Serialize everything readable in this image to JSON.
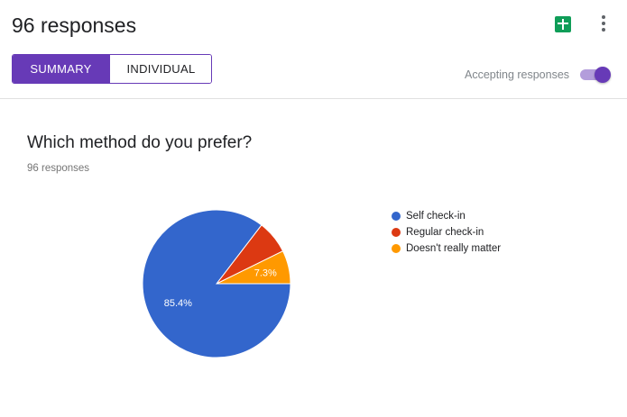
{
  "header": {
    "title": "96 responses",
    "sheets_icon": "google-sheets-icon",
    "more_icon": "more-vert-icon"
  },
  "tabs": [
    {
      "label": "SUMMARY",
      "active": true
    },
    {
      "label": "INDIVIDUAL",
      "active": false
    }
  ],
  "accepting": {
    "label": "Accepting responses",
    "enabled": true
  },
  "question": {
    "title": "Which method do you prefer?",
    "response_count": "96 responses"
  },
  "chart_data": {
    "type": "pie",
    "slices": [
      {
        "label": "Self check-in",
        "value": 85.4,
        "color": "#3366cc",
        "data_label": "85.4%"
      },
      {
        "label": "Regular check-in",
        "value": 7.3,
        "color": "#dc3912",
        "data_label": ""
      },
      {
        "label": "Doesn't really matter",
        "value": 7.3,
        "color": "#ff9900",
        "data_label": "7.3%"
      }
    ],
    "legend_position": "right"
  },
  "colors": {
    "accent": "#673ab7",
    "accent_light": "#b39ddb"
  }
}
